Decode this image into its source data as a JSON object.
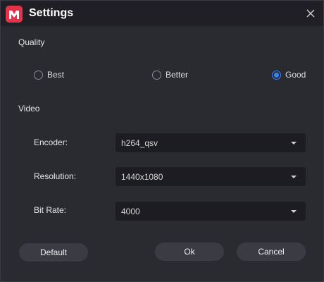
{
  "window": {
    "title": "Settings",
    "close_icon": "close-icon",
    "app_icon": "app-logo-icon"
  },
  "quality": {
    "label": "Quality",
    "options": [
      {
        "label": "Best",
        "checked": false
      },
      {
        "label": "Better",
        "checked": false
      },
      {
        "label": "Good",
        "checked": true
      }
    ]
  },
  "video": {
    "label": "Video",
    "fields": [
      {
        "label": "Encoder:",
        "value": "h264_qsv"
      },
      {
        "label": "Resolution:",
        "value": "1440x1080"
      },
      {
        "label": "Bit Rate:",
        "value": "4000"
      }
    ]
  },
  "buttons": {
    "default": "Default",
    "ok": "Ok",
    "cancel": "Cancel"
  },
  "colors": {
    "accent": "#3b82f6",
    "brand": "#e2334b",
    "background": "#2a2a31"
  }
}
